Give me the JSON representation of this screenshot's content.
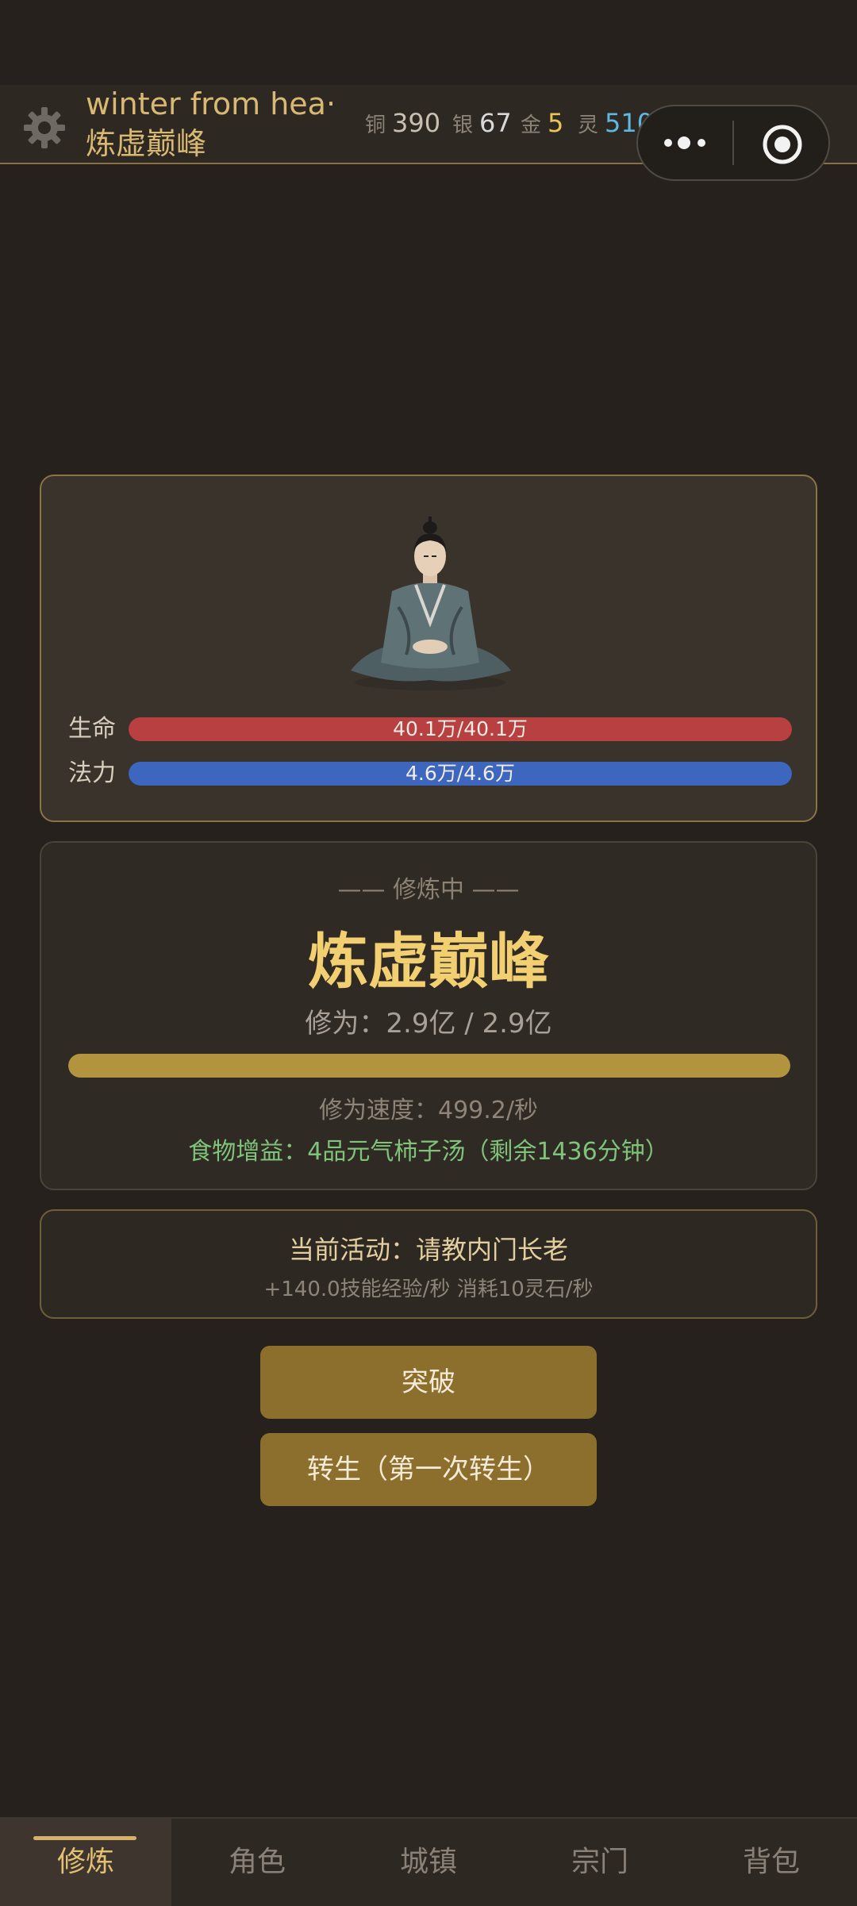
{
  "header": {
    "player_name": "winter from hea·",
    "realm": "炼虚巅峰",
    "currencies": [
      {
        "label": "铜",
        "value": "390",
        "color": "#c9c0b2"
      },
      {
        "label": "银",
        "value": "67",
        "color": "#d8d8d8"
      },
      {
        "label": "金",
        "value": "5",
        "color": "#e8c65a"
      },
      {
        "label": "灵",
        "value": "510.2万",
        "color": "#5fb8e0"
      }
    ],
    "icons": {
      "settings": "gear-icon",
      "more": "more-dots-icon",
      "close": "target-circle-icon"
    }
  },
  "status": {
    "hp": {
      "label": "生命",
      "text": "40.1万/40.1万",
      "fraction": 1.0,
      "color": "#b84040"
    },
    "mp": {
      "label": "法力",
      "text": "4.6万/4.6万",
      "fraction": 1.0,
      "color": "#3d66bf"
    }
  },
  "cultivation": {
    "state": "—— 修炼中 ——",
    "realm": "炼虚巅峰",
    "progress_text": "修为：2.9亿 / 2.9亿",
    "progress_fraction": 1.0,
    "speed": "修为速度：499.2/秒",
    "food_bonus": "食物增益：4品元气柿子汤（剩余1436分钟）"
  },
  "activity": {
    "title": "当前活动：请教内门长老",
    "detail": "+140.0技能经验/秒  消耗10灵石/秒"
  },
  "buttons": {
    "breakthrough": "突破",
    "rebirth": "转生（第一次转生）"
  },
  "nav": {
    "tabs": [
      "修炼",
      "角色",
      "城镇",
      "宗门",
      "背包"
    ],
    "active": 0
  }
}
